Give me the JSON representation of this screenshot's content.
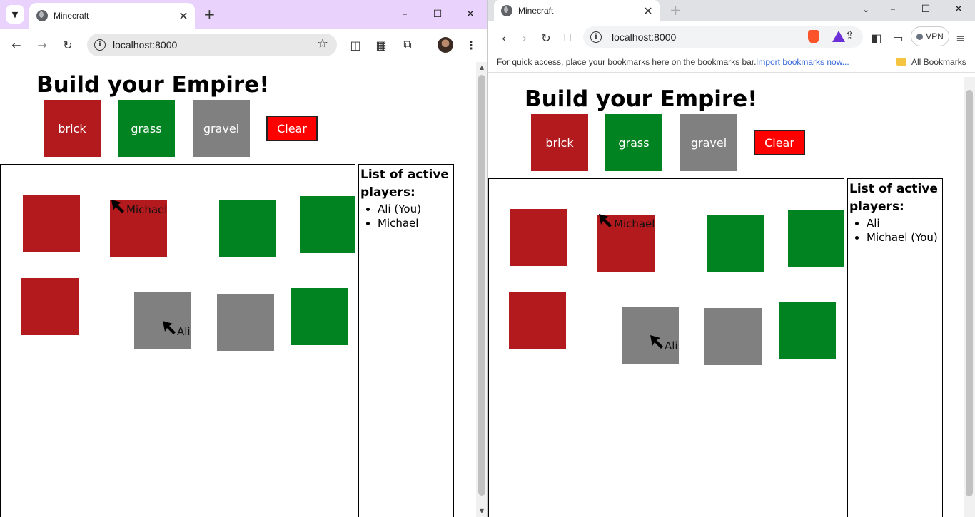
{
  "left_window": {
    "tab_title": "Minecraft",
    "url": "localhost:8000",
    "controls": {
      "minimize": "–",
      "maximize": "☐",
      "close": "✕"
    }
  },
  "right_window": {
    "tab_title": "Minecraft",
    "url": "localhost:8000",
    "vpn_label": "VPN",
    "bookmarks_bar": {
      "hint": "For quick access, place your bookmarks here on the bookmarks bar.",
      "import_link": "Import bookmarks now...",
      "all_bookmarks": "All Bookmarks"
    }
  },
  "colors": {
    "brick": "#b21a1e",
    "grass": "#018321",
    "gravel": "#808080",
    "clear": "#ff0000"
  },
  "app": {
    "title": "Build your Empire!",
    "tile_buttons": [
      {
        "label": "brick",
        "color": "#b21a1e"
      },
      {
        "label": "grass",
        "color": "#018321"
      },
      {
        "label": "gravel",
        "color": "#808080"
      }
    ],
    "clear_label": "Clear",
    "players_title": "List of active players:"
  },
  "left_players": [
    "Ali (You)",
    "Michael"
  ],
  "right_players": [
    "Ali",
    "Michael (You)"
  ],
  "cursor_names": {
    "michael": "Michael",
    "ali": "Ali"
  }
}
